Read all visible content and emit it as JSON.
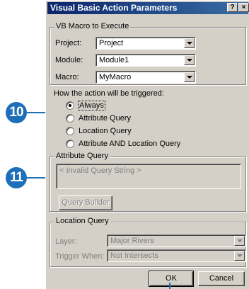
{
  "titlebar": {
    "title": "Visual Basic Action Parameters",
    "help_label": "?",
    "close_label": "×"
  },
  "vb_macro": {
    "legend": "VB Macro to Execute",
    "project_label": "Project:",
    "project_value": "Project",
    "module_label": "Module:",
    "module_value": "Module1",
    "macro_label": "Macro:",
    "macro_value": "MyMacro"
  },
  "trigger": {
    "label": "How the action will be triggered:",
    "options": [
      {
        "label": "Always",
        "checked": true
      },
      {
        "label": "Attribute Query",
        "checked": false
      },
      {
        "label": "Location Query",
        "checked": false
      },
      {
        "label": "Attribute AND Location Query",
        "checked": false
      }
    ]
  },
  "attribute_query": {
    "legend": "Attribute Query",
    "query_text": "< Invalid Query String >",
    "builder_label": "Query Builder"
  },
  "location_query": {
    "legend": "Location Query",
    "layer_label": "Layer:",
    "layer_value": "Major Rivers",
    "trigger_label": "Trigger When:",
    "trigger_value": "Not Intersects"
  },
  "buttons": {
    "ok_label": "OK",
    "cancel_label": "Cancel"
  },
  "callouts": {
    "c10": "10",
    "c11": "11"
  },
  "colors": {
    "callout": "#1c6fb8",
    "titlebar": "#0a246a",
    "dialog_bg": "#d4d0c8"
  }
}
